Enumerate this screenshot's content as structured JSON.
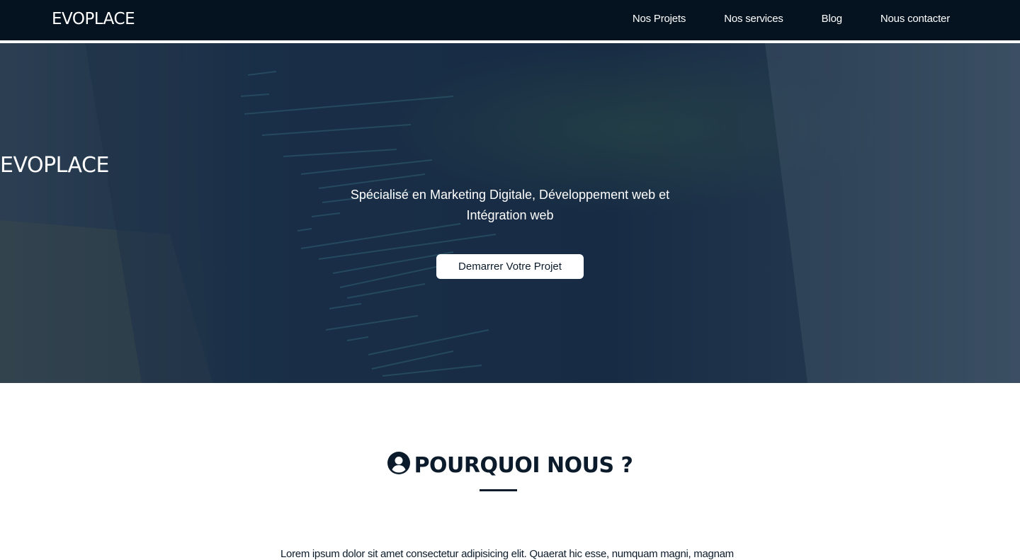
{
  "nav": {
    "brand": "EVOPLACE",
    "links": [
      {
        "label": "Nos Projets"
      },
      {
        "label": "Nos services"
      },
      {
        "label": "Blog"
      },
      {
        "label": "Nous contacter"
      }
    ]
  },
  "hero": {
    "title": "EVOPLACE",
    "subtitle": "Spécialisé en Marketing Digitale, Développement web et Intégration web",
    "cta_label": "Demarrer Votre Projet"
  },
  "why": {
    "icon": "user-circle-icon",
    "title": "POURQUOI NOUS ?",
    "body": "Lorem ipsum dolor sit amet consectetur adipisicing elit. Quaerat hic esse, numquam magni, magnam"
  },
  "colors": {
    "navbar_bg": "#051320",
    "hero_overlay": "#1b2e45",
    "text_dark": "#0b1b2b",
    "white": "#ffffff"
  }
}
